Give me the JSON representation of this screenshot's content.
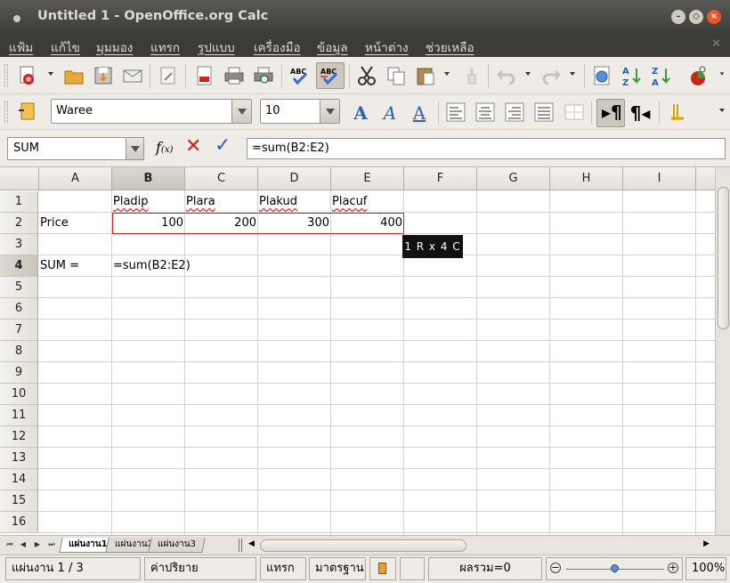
{
  "window": {
    "title": "Untitled 1 - OpenOffice.org Calc"
  },
  "menu": [
    "แฟ้ม",
    "แก้ไข",
    "มุมมอง",
    "แทรก",
    "รูปแบบ",
    "เครื่องมือ",
    "ข้อมูล",
    "หน้าต่าง",
    "ช่วยเหลือ"
  ],
  "format_toolbar": {
    "font_name": "Waree",
    "font_size": "10"
  },
  "formula_bar": {
    "name_box": "SUM",
    "formula": "=sum(B2:E2)"
  },
  "columns": [
    "A",
    "B",
    "C",
    "D",
    "E",
    "F",
    "G",
    "H",
    "I"
  ],
  "selected_column": "B",
  "rows": [
    "1",
    "2",
    "3",
    "4",
    "5",
    "6",
    "7",
    "8",
    "9",
    "10",
    "11",
    "12",
    "13",
    "14",
    "15",
    "16"
  ],
  "selected_row": "4",
  "cells": {
    "B1": "Pladip",
    "C1": "Plara",
    "D1": "Plakud",
    "E1": "Placuf",
    "A2": "Price",
    "B2": "100",
    "C2": "200",
    "D2": "300",
    "E2": "400",
    "A4": "SUM =",
    "B4": "=sum(B2:E2)"
  },
  "tooltip": "1 R x 4 C",
  "sheets": [
    "แผ่นงาน1",
    "แผ่นงาน2",
    "แผ่นงาน3"
  ],
  "status": {
    "sheet": "แผ่นงาน 1 / 3",
    "style": "ค่าปริยาย",
    "insert_mode": "แทรก",
    "selection_mode": "มาตรฐาน",
    "sum": "ผลรวม=0",
    "zoom": "100%"
  },
  "colors": {
    "selection": "#e02020",
    "titlebar": "#3c3b37"
  }
}
